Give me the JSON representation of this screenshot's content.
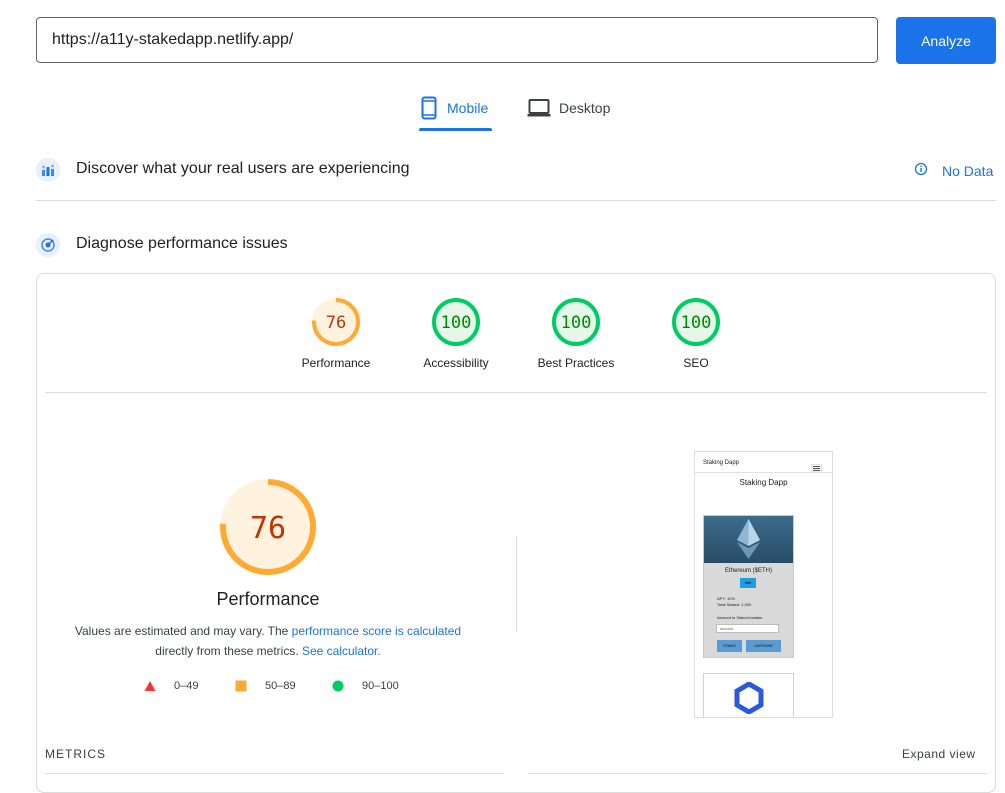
{
  "url_input": {
    "value": "https://a11y-stakedapp.netlify.app/"
  },
  "analyze_label": "Analyze",
  "tabs": [
    {
      "label": "Mobile",
      "selected": true,
      "icon": "smartphone-icon"
    },
    {
      "label": "Desktop",
      "selected": false,
      "icon": "laptop-icon"
    }
  ],
  "crux": {
    "title": "Discover what your real users are experiencing",
    "status": "No Data"
  },
  "diagnose": {
    "title": "Diagnose performance issues"
  },
  "scores": [
    {
      "label": "Performance",
      "value": "76",
      "score": 76,
      "color": "#fa3",
      "text_color": "#c33300",
      "fill": "#fff3e0"
    },
    {
      "label": "Accessibility",
      "value": "100",
      "score": 100,
      "color": "#0c6",
      "text_color": "#008800",
      "fill": "#e6f7ea"
    },
    {
      "label": "Best Practices",
      "value": "100",
      "score": 100,
      "color": "#0c6",
      "text_color": "#008800",
      "fill": "#e6f7ea"
    },
    {
      "label": "SEO",
      "value": "100",
      "score": 100,
      "color": "#0c6",
      "text_color": "#008800",
      "fill": "#e6f7ea"
    }
  ],
  "performance_detail": {
    "value": "76",
    "score": 76,
    "title": "Performance",
    "desc_prefix": "Values are estimated and may vary. The ",
    "desc_link": "performance score is calculated",
    "desc_mid": "directly from these metrics. ",
    "desc_link2": "See calculator."
  },
  "legend": [
    {
      "range": "0–49",
      "shape": "triangle",
      "color": "#f33"
    },
    {
      "range": "50–89",
      "shape": "square",
      "color": "#fa3"
    },
    {
      "range": "90–100",
      "shape": "circle",
      "color": "#0c6"
    }
  ],
  "thumbnail": {
    "header": "Staking Dapp",
    "title": "Staking Dapp",
    "token_name": "Ethereum ($ETH)",
    "info_label": "Info",
    "apy": "APY: 10%",
    "total_staked": "Total Staked: 1,000",
    "amount_label": "Amount to Stake/Unstake",
    "amount_placeholder": "amount",
    "stake_label": "STAKE",
    "unstake_label": "UNSTAKE"
  },
  "metrics_label": "METRICS",
  "expand_label": "Expand view"
}
